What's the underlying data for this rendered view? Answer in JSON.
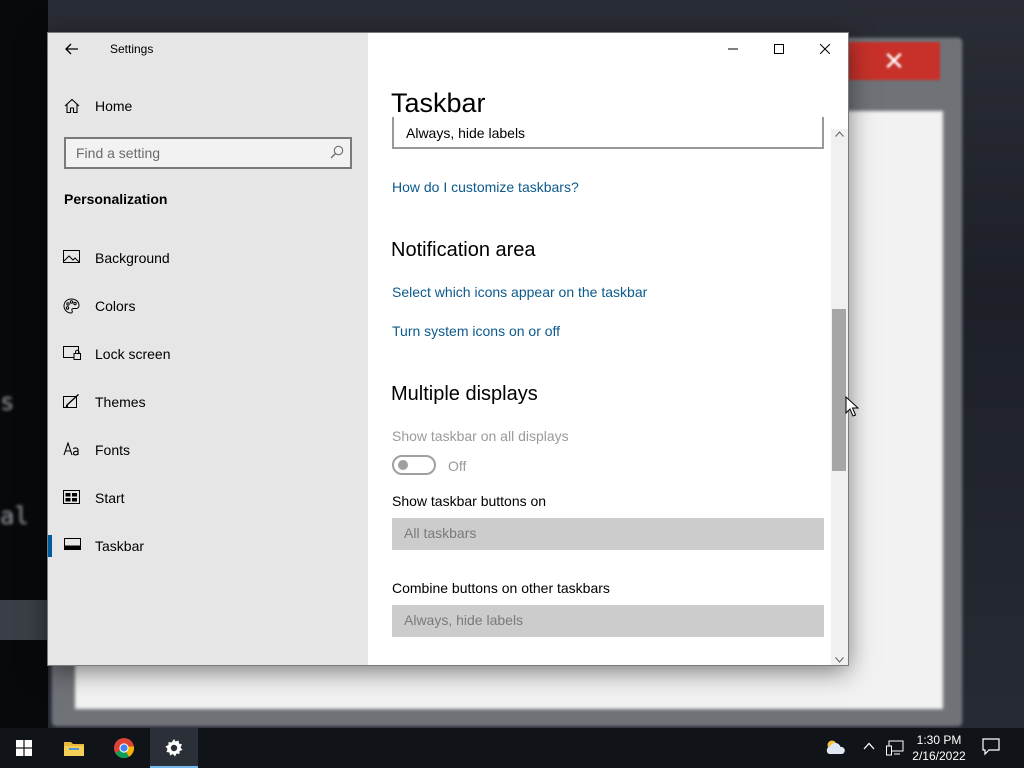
{
  "window": {
    "app_title": "Settings"
  },
  "sidebar": {
    "home_label": "Home",
    "search_placeholder": "Find a setting",
    "section_label": "Personalization",
    "items": [
      {
        "label": "Background",
        "icon": "background-icon"
      },
      {
        "label": "Colors",
        "icon": "colors-icon"
      },
      {
        "label": "Lock screen",
        "icon": "lock-screen-icon"
      },
      {
        "label": "Themes",
        "icon": "themes-icon"
      },
      {
        "label": "Fonts",
        "icon": "fonts-icon"
      },
      {
        "label": "Start",
        "icon": "start-icon"
      },
      {
        "label": "Taskbar",
        "icon": "taskbar-icon",
        "selected": true
      }
    ]
  },
  "content": {
    "page_title": "Taskbar",
    "top_dropdown_value": "Always, hide labels",
    "customize_link": "How do I customize taskbars?",
    "notification_area": {
      "heading": "Notification area",
      "link_icons": "Select which icons appear on the taskbar",
      "link_system_icons": "Turn system icons on or off"
    },
    "multiple_displays": {
      "heading": "Multiple displays",
      "show_on_all_label": "Show taskbar on all displays",
      "toggle_state": "Off",
      "buttons_on_label": "Show taskbar buttons on",
      "buttons_on_value": "All taskbars",
      "combine_label": "Combine buttons on other taskbars",
      "combine_value": "Always, hide labels"
    }
  },
  "taskbar": {
    "time": "1:30 PM",
    "date": "2/16/2022",
    "pinned": [
      "windows-start-icon",
      "file-explorer-icon",
      "chrome-icon",
      "settings-icon"
    ]
  },
  "colors": {
    "accent": "#005a9e",
    "link": "#0b5a8e",
    "sidebar_bg": "#e6e6e6",
    "taskbar_bg": "#101418"
  },
  "background_text": {
    "term_line_1": "s",
    "term_line_2": "al"
  }
}
